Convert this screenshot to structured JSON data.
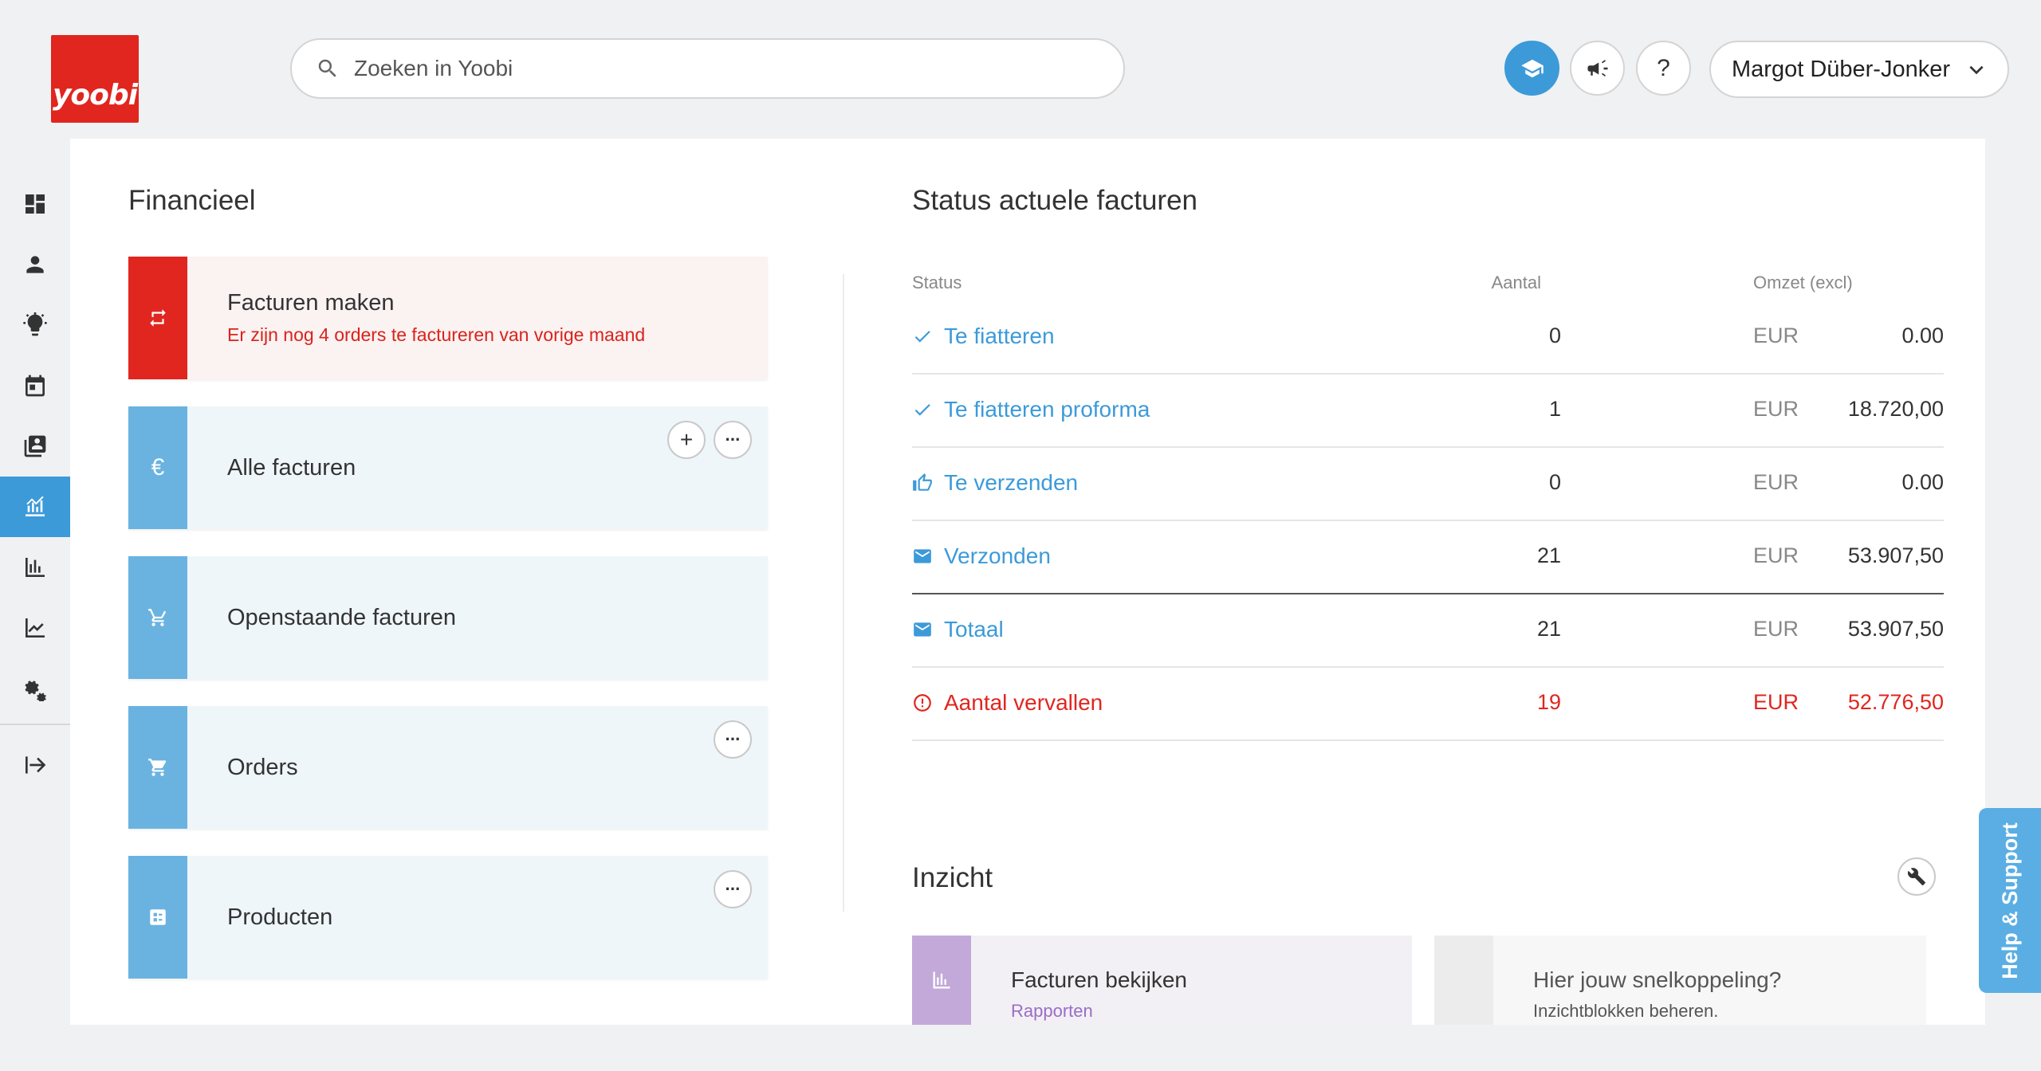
{
  "logo": {
    "text": "yoobi",
    "color": "#e0261f"
  },
  "search": {
    "placeholder": "Zoeken in Yoobi",
    "icon": "search-icon"
  },
  "header": {
    "buttons": [
      "academy-icon",
      "announcement-icon",
      "help-icon"
    ],
    "help_label": "?",
    "user_name": "Margot Düber-Jonker"
  },
  "sidenav": {
    "items": [
      {
        "icon": "dashboard-icon"
      },
      {
        "icon": "person-icon"
      },
      {
        "icon": "lightbulb-icon"
      },
      {
        "icon": "calendar-icon"
      },
      {
        "icon": "contacts-icon"
      },
      {
        "icon": "finance-icon",
        "active": true
      },
      {
        "icon": "bar-chart-icon"
      },
      {
        "icon": "line-chart-icon"
      },
      {
        "icon": "settings-icon"
      },
      {
        "icon": "logout-icon"
      }
    ],
    "accent": "#3c9ad9"
  },
  "financieel": {
    "title": "Financieel",
    "tiles": [
      {
        "title": "Facturen maken",
        "subtitle": "Er zijn nog 4 orders te factureren van vorige maand",
        "icon": "repeat-icon",
        "color": "#e0261f"
      },
      {
        "title": "Alle facturen",
        "icon": "euro-icon",
        "euro": "€",
        "actions": [
          "+",
          "···"
        ]
      },
      {
        "title": "Openstaande facturen",
        "icon": "cart-outline-icon"
      },
      {
        "title": "Orders",
        "icon": "cart-icon",
        "actions": [
          "···"
        ]
      },
      {
        "title": "Producten",
        "icon": "product-list-icon",
        "actions": [
          "···"
        ]
      }
    ]
  },
  "status": {
    "title": "Status actuele facturen",
    "columns": {
      "status": "Status",
      "count": "Aantal",
      "revenue": "Omzet (excl)"
    },
    "rows": [
      {
        "label": "Te fiatteren",
        "icon": "check-icon",
        "count": "0",
        "currency": "EUR",
        "amount": "0.00"
      },
      {
        "label": "Te fiatteren proforma",
        "icon": "check-icon",
        "count": "1",
        "currency": "EUR",
        "amount": "18.720,00"
      },
      {
        "label": "Te verzenden",
        "icon": "thumbs-up-icon",
        "count": "0",
        "currency": "EUR",
        "amount": "0.00"
      },
      {
        "label": "Verzonden",
        "icon": "mail-icon",
        "count": "21",
        "currency": "EUR",
        "amount": "53.907,50"
      },
      {
        "label": "Totaal",
        "icon": "mail-icon",
        "count": "21",
        "currency": "EUR",
        "amount": "53.907,50"
      },
      {
        "label": "Aantal vervallen",
        "icon": "alert-circle-icon",
        "count": "19",
        "currency": "EUR",
        "amount": "52.776,50",
        "alert_color": "#e0261f"
      }
    ]
  },
  "inzicht": {
    "title": "Inzicht",
    "tiles": [
      {
        "title": "Facturen bekijken",
        "subtitle": "Rapporten",
        "icon": "report-chart-icon",
        "color": "#c3a9d9",
        "subtitle_color": "#9a6dc7"
      },
      {
        "title": "Hier jouw snelkoppeling?",
        "subtitle": "Inzichtblokken beheren."
      }
    ]
  },
  "help_tab": {
    "label": "Help & Support"
  }
}
